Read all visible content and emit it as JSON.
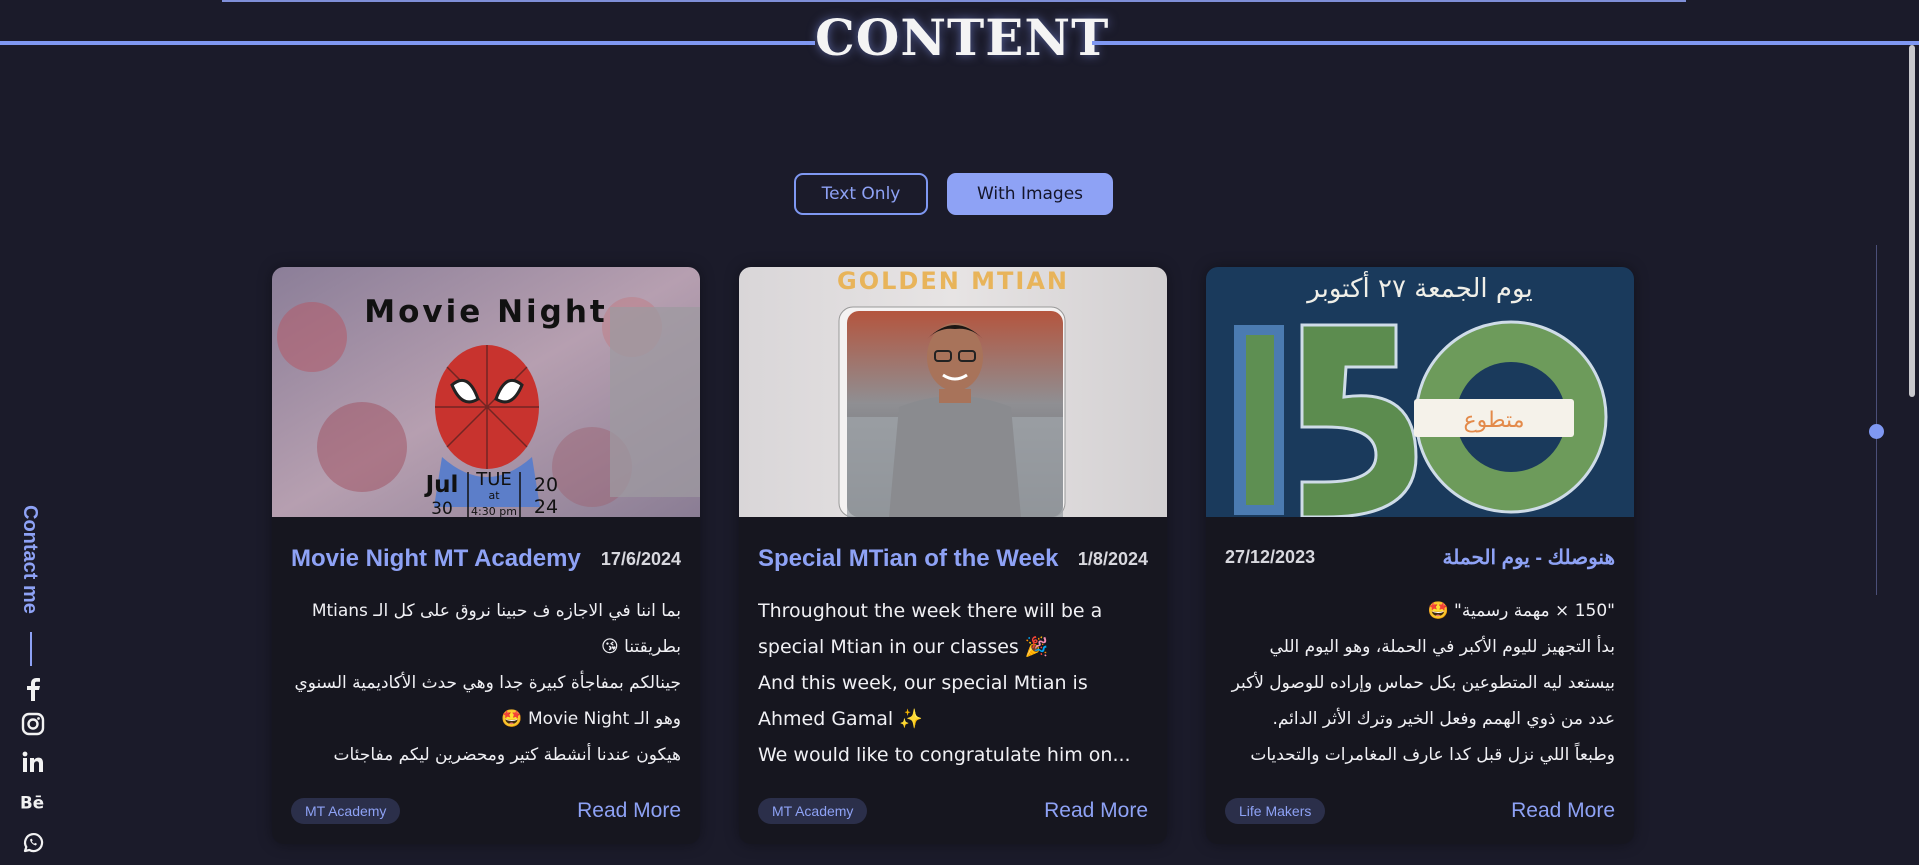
{
  "section": {
    "title": "CONTENT"
  },
  "toggle": {
    "text_only": "Text Only",
    "with_images": "With Images",
    "active": "With Images"
  },
  "cards": [
    {
      "title": "Movie Night MT Academy",
      "date": "17/6/2024",
      "body": [
        "بما اننا في الاجازه ف حبينا نروق على كل الـ Mtians بطريقتنا 😘",
        "جينالكم بمفاجأة كبيرة جدا وهي حدث الأكاديمية السنوي وهو الـ Movie Night 🤩",
        "هيكون عندنا أنشطة كتير ومحضرين ليكم مفاجئات هتعجبكم..."
      ],
      "direction": "rtl",
      "tag": "MT Academy",
      "read_more": "Read More",
      "image": {
        "heading": "Movie Night",
        "month": "Jul",
        "day_name": "TUE",
        "day_number": "30",
        "at": "at",
        "time": "4:30 pm",
        "year_top": "20",
        "year_bottom": "24"
      }
    },
    {
      "title": "Special MTian of the Week",
      "date": "1/8/2024",
      "body": [
        "Throughout the week there will be a special Mtian in our classes 🎉",
        "And this week, our special Mtian is Ahmed Gamal ✨",
        "We would like to congratulate him on..."
      ],
      "direction": "ltr",
      "tag": "MT Academy",
      "read_more": "Read More",
      "image": {
        "heading": "GOLDEN MTIAN"
      }
    },
    {
      "title": "هنوصلك - يوم الحملة",
      "date": "27/12/2023",
      "body": [
        "\"150 × مهمة رسمية\" 🤩",
        "بدأ التجهيز لليوم الأكبر في الحملة، وهو اليوم اللي بيستعد ليه المتطوعين بكل حماس وإراده للوصول لأكبر عدد من ذوي الهمم وفعل الخير وترك الأثر الدائم.",
        "وطبعاً اللي نزل قبل كدا عارف المغامرات والتحديات اللي..."
      ],
      "direction": "rtl",
      "tag": "Life Makers",
      "read_more": "Read More",
      "image": {
        "heading": "يوم الجمعة ٢٧ أكتوبر",
        "number": "150",
        "badge": "متطوع"
      }
    }
  ],
  "contact": {
    "label": "Contact me"
  },
  "social_icons": [
    "facebook-icon",
    "instagram-icon",
    "linkedin-icon",
    "behance-icon",
    "whatsapp-icon"
  ],
  "colors": {
    "accent": "#8ea2f5",
    "background": "#1b1b2a",
    "card": "#16161f",
    "tag_bg": "#2b2f4a"
  }
}
